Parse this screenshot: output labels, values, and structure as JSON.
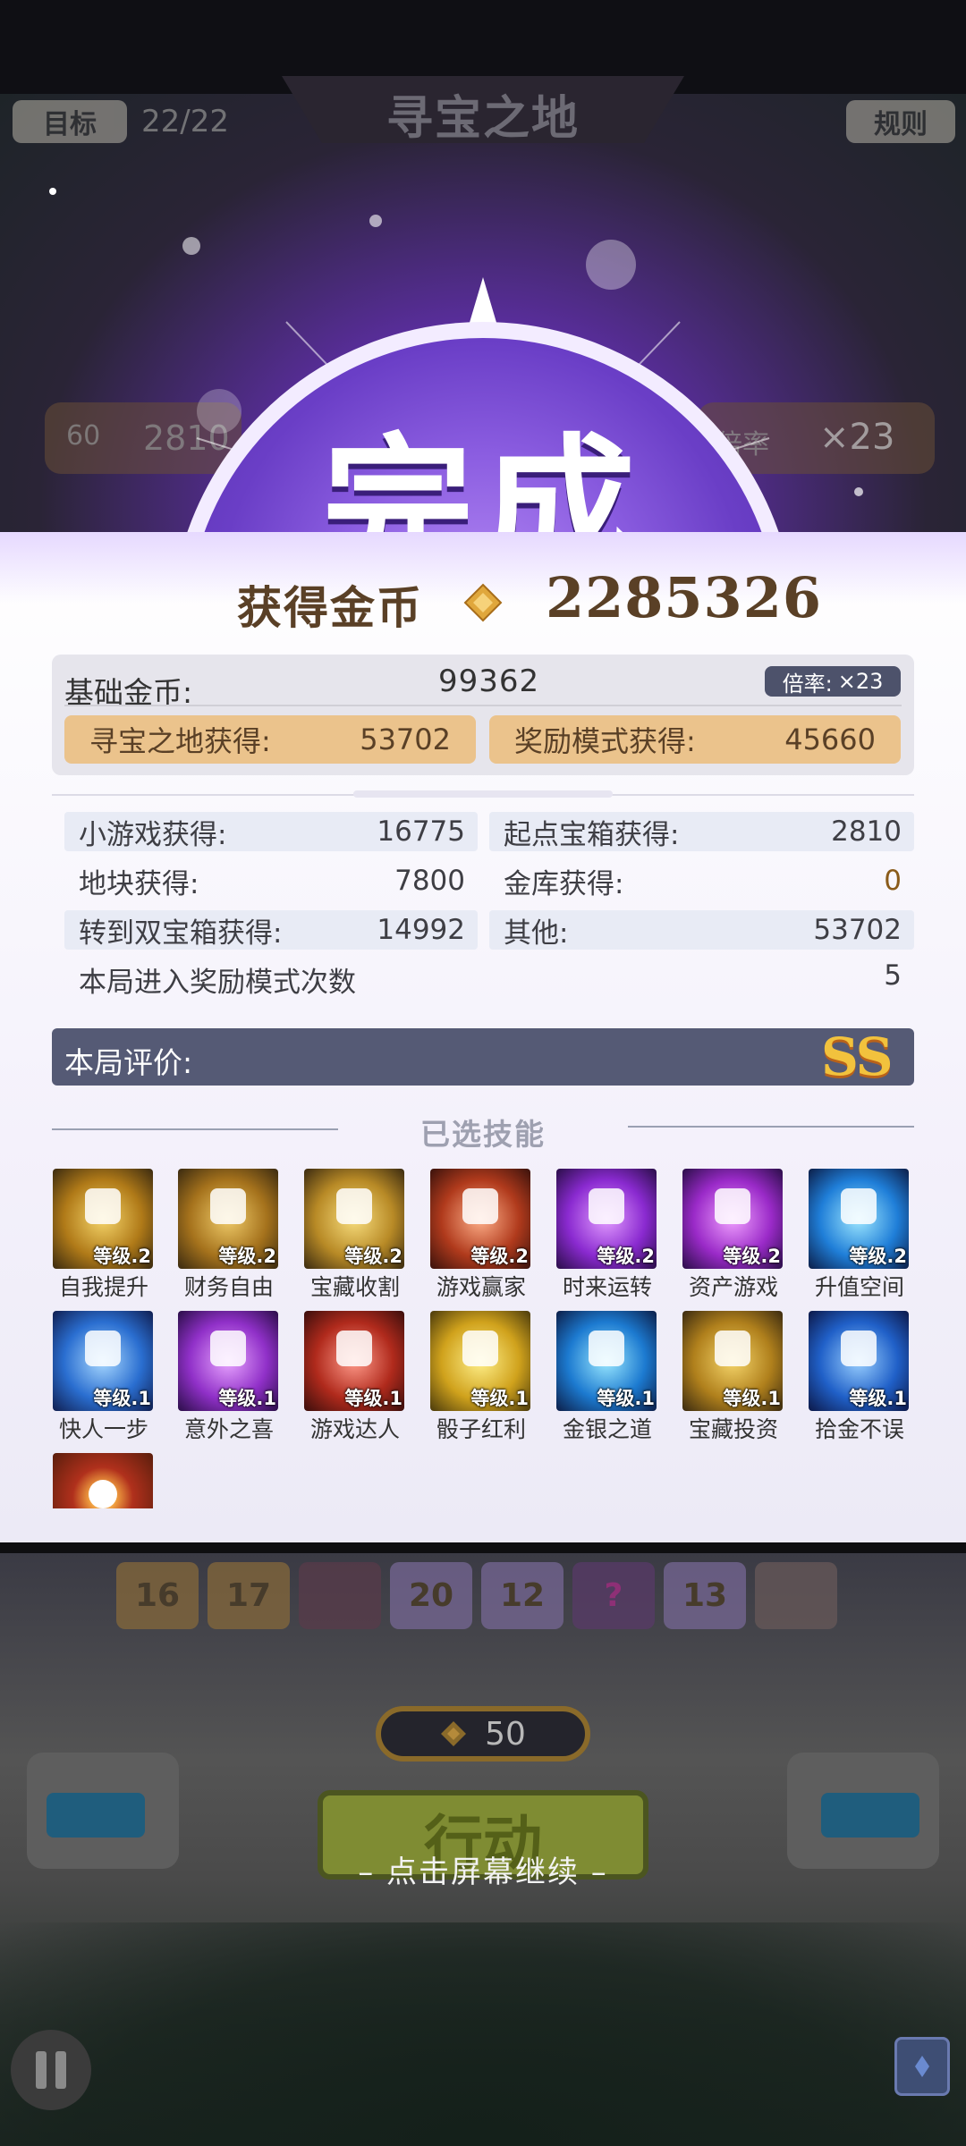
{
  "top": {
    "goal_label": "目标",
    "progress": "22/22",
    "title": "寻宝之地",
    "rules_label": "规则",
    "left_plate_icon_text": "60",
    "left_plate_value": "2810",
    "right_plate_label": "倍率",
    "right_plate_value": "×23"
  },
  "badge": {
    "text": "完成"
  },
  "coins": {
    "label": "获得金币",
    "icon": "gold-coin-icon",
    "total": "2285326"
  },
  "base": {
    "label": "基础金币:",
    "value": "99362",
    "rate_label": "倍率:",
    "rate_value": "×23",
    "treasure_label": "寻宝之地获得:",
    "treasure_value": "53702",
    "reward_label": "奖励模式获得:",
    "reward_value": "45660"
  },
  "stats": {
    "minigame_label": "小游戏获得:",
    "minigame_value": "16775",
    "start_chest_label": "起点宝箱获得:",
    "start_chest_value": "2810",
    "tile_label": "地块获得:",
    "tile_value": "7800",
    "vault_label": "金库获得:",
    "vault_value": "0",
    "double_chest_label": "转到双宝箱获得:",
    "double_chest_value": "14992",
    "other_label": "其他:",
    "other_value": "53702",
    "reward_times_label": "本局进入奖励模式次数",
    "reward_times_value": "5"
  },
  "evaluation": {
    "label": "本局评价:",
    "grade": "SS"
  },
  "skills": {
    "title": "已选技能",
    "items": [
      {
        "name": "自我提升",
        "level": "等级.2"
      },
      {
        "name": "财务自由",
        "level": "等级.2"
      },
      {
        "name": "宝藏收割",
        "level": "等级.2"
      },
      {
        "name": "游戏赢家",
        "level": "等级.2"
      },
      {
        "name": "时来运转",
        "level": "等级.2"
      },
      {
        "name": "资产游戏",
        "level": "等级.2"
      },
      {
        "name": "升值空间",
        "level": "等级.2"
      },
      {
        "name": "快人一步",
        "level": "等级.1"
      },
      {
        "name": "意外之喜",
        "level": "等级.1"
      },
      {
        "name": "游戏达人",
        "level": "等级.1"
      },
      {
        "name": "骰子红利",
        "level": "等级.1"
      },
      {
        "name": "金银之道",
        "level": "等级.1"
      },
      {
        "name": "宝藏投资",
        "level": "等级.1"
      },
      {
        "name": "拾金不误",
        "level": "等级.1"
      }
    ]
  },
  "board": {
    "tiles": [
      "16",
      "17",
      "",
      "20",
      "12",
      "?",
      "13",
      ""
    ],
    "dice_cost": "50",
    "action_label": "行动",
    "continue_hint": "– 点击屏幕继续 –"
  },
  "colors": {
    "purple_badge": "#7a4ed6",
    "coin_text": "#5a4026",
    "pill_bg": "#ebc38c",
    "eval_bar": "#555a75",
    "grade_gold": "#f2c23d"
  }
}
